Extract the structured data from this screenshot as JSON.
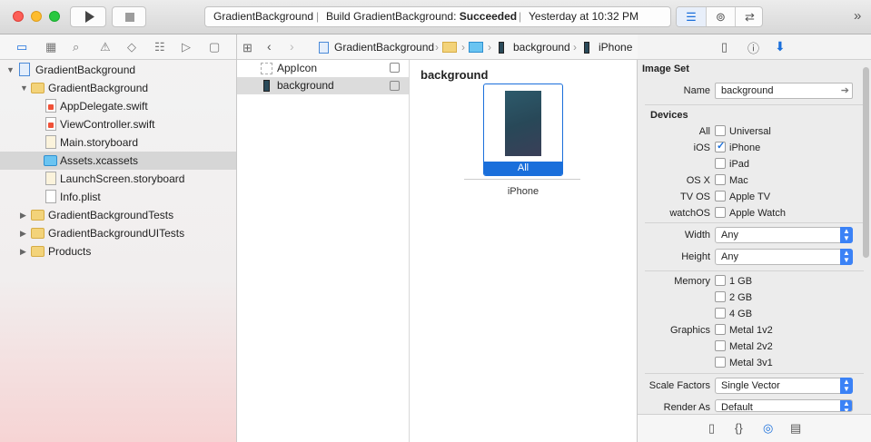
{
  "toolbar": {
    "status_project": "GradientBackground",
    "status_build_prefix": "Build GradientBackground: ",
    "status_build_result": "Succeeded",
    "status_time": "Yesterday at 10:32 PM",
    "overflow": "»"
  },
  "navigator": {
    "items": [
      {
        "label": "GradientBackground"
      },
      {
        "label": "GradientBackground"
      },
      {
        "label": "AppDelegate.swift"
      },
      {
        "label": "ViewController.swift"
      },
      {
        "label": "Main.storyboard"
      },
      {
        "label": "Assets.xcassets"
      },
      {
        "label": "LaunchScreen.storyboard"
      },
      {
        "label": "Info.plist"
      },
      {
        "label": "GradientBackgroundTests"
      },
      {
        "label": "GradientBackgroundUITests"
      },
      {
        "label": "Products"
      }
    ]
  },
  "jumpbar": {
    "project": "GradientBackground",
    "asset": "background",
    "device": "iPhone"
  },
  "assets": {
    "items": [
      {
        "label": "AppIcon"
      },
      {
        "label": "background"
      }
    ]
  },
  "canvas": {
    "title": "background",
    "slot_label": "All",
    "device_label": "iPhone"
  },
  "inspector": {
    "section_title": "Image Set",
    "name_label": "Name",
    "name_value": "background",
    "devices_title": "Devices",
    "devices": [
      {
        "group": "All",
        "label": "Universal",
        "checked": false
      },
      {
        "group": "iOS",
        "label": "iPhone",
        "checked": true
      },
      {
        "group": "",
        "label": "iPad",
        "checked": false
      },
      {
        "group": "OS X",
        "label": "Mac",
        "checked": false
      },
      {
        "group": "TV OS",
        "label": "Apple TV",
        "checked": false
      },
      {
        "group": "watchOS",
        "label": "Apple Watch",
        "checked": false
      }
    ],
    "width_label": "Width",
    "width_value": "Any",
    "height_label": "Height",
    "height_value": "Any",
    "memory_label": "Memory",
    "memory": [
      "1 GB",
      "2 GB",
      "4 GB"
    ],
    "graphics_label": "Graphics",
    "graphics": [
      "Metal 1v2",
      "Metal 2v2",
      "Metal 3v1"
    ],
    "scale_label": "Scale Factors",
    "scale_value": "Single Vector",
    "render_label": "Render As",
    "render_value": "Default"
  },
  "colors": {
    "accent": "#1a6fdb",
    "selection": "#d6d6d6",
    "folder": "#f3d37a"
  }
}
